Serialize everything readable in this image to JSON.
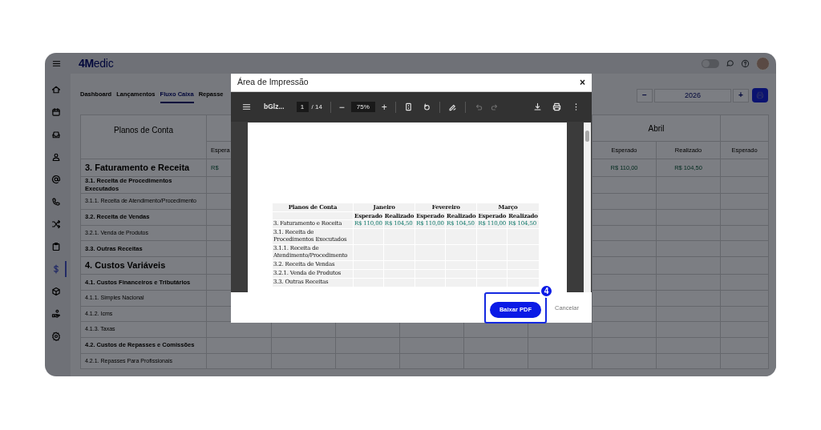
{
  "app": {
    "logo": "**4M**edic",
    "theme_toggle": {
      "on": false
    },
    "sidebar": [
      {
        "selected": false
      },
      {
        "selected": false
      },
      {
        "selected": false
      },
      {
        "selected": false
      },
      {
        "selected": false
      },
      {
        "selected": false
      },
      {
        "selected": false
      },
      {
        "selected": false
      },
      {
        "selected": true
      },
      {
        "selected": false
      },
      {
        "selected": false
      },
      {
        "selected": false
      }
    ]
  },
  "tabs": [
    {
      "label": "Dashboard",
      "selected": false
    },
    {
      "label": "Lançamentos",
      "selected": false
    },
    {
      "label": "Fluxo Caixa",
      "selected": true
    },
    {
      "label": "Repasse",
      "selected": false
    }
  ],
  "year_control": {
    "decrement": "−",
    "value": "2026",
    "increment": "+"
  },
  "table": {
    "header": "Planos de Conta",
    "month_header": "Abril",
    "subheaders_left": [
      "Espera"
    ],
    "subheaders_right": [
      "Esperado",
      "Realizado",
      "Esperado"
    ],
    "rows": [
      {
        "label": "3. Faturamento e Receita",
        "kind": "group",
        "values_left": [
          "R$"
        ],
        "values_right": [
          "R$ 110,00",
          "R$ 104,50"
        ]
      },
      {
        "label": "3.1. Receita de Procedimentos Executados",
        "kind": "section"
      },
      {
        "label": "3.1.1. Receita de Atendimento/Procedimento",
        "kind": "item"
      },
      {
        "label": "3.2. Receita de Vendas",
        "kind": "section"
      },
      {
        "label": "3.2.1. Venda de Produtos",
        "kind": "item"
      },
      {
        "label": "3.3. Outras Receitas",
        "kind": "section"
      },
      {
        "label": "4. Custos Variáveis",
        "kind": "group"
      },
      {
        "label": "4.1. Custos Financeiros e Tributários",
        "kind": "section"
      },
      {
        "label": "4.1.1. Simples Nacional",
        "kind": "item"
      },
      {
        "label": "4.1.2. Icms",
        "kind": "item"
      },
      {
        "label": "4.1.3. Taxas",
        "kind": "item"
      },
      {
        "label": "4.2. Custos de Repasses e Comissões",
        "kind": "section"
      },
      {
        "label": "4.2.1. Repasses Para Profissionais",
        "kind": "item"
      }
    ]
  },
  "dialog": {
    "title": "Área de Impressão",
    "close": "×",
    "viewer": {
      "file_name": "bGlz...",
      "page": "1",
      "page_total": "/ 14",
      "zoom_out": "−",
      "zoom": "75%",
      "zoom_in": "+",
      "undo": {
        "disabled": true
      },
      "redo": {
        "disabled": true
      },
      "document": {
        "header": "Planos de Conta",
        "months": [
          {
            "name": "Janeiro",
            "expected": "Esperado",
            "actual": "Realizado"
          },
          {
            "name": "Fevereiro",
            "expected": "Esperado",
            "actual": "Realizado"
          },
          {
            "name": "Março",
            "expected": "Esperado",
            "actual": "Realizado"
          }
        ],
        "rows": [
          {
            "label": "3. Faturamento e Receita",
            "values": [
              "R$ 110,00",
              "R$ 104,50",
              "R$ 110,00",
              "R$ 104,50",
              "R$ 110,00",
              "R$ 104,50"
            ]
          },
          {
            "label": "3.1. Receita de Procedimentos Executados"
          },
          {
            "label": "3.1.1. Receita de Atendimento/Procedimento"
          },
          {
            "label": "3.2. Receita de Vendas"
          },
          {
            "label": "3.2.1. Venda de Produtos"
          },
          {
            "label": "3.3. Outras Receitas"
          }
        ]
      }
    },
    "download_button": "Baixar PDF",
    "cancel": "Cancelar",
    "step_badge": "4"
  }
}
